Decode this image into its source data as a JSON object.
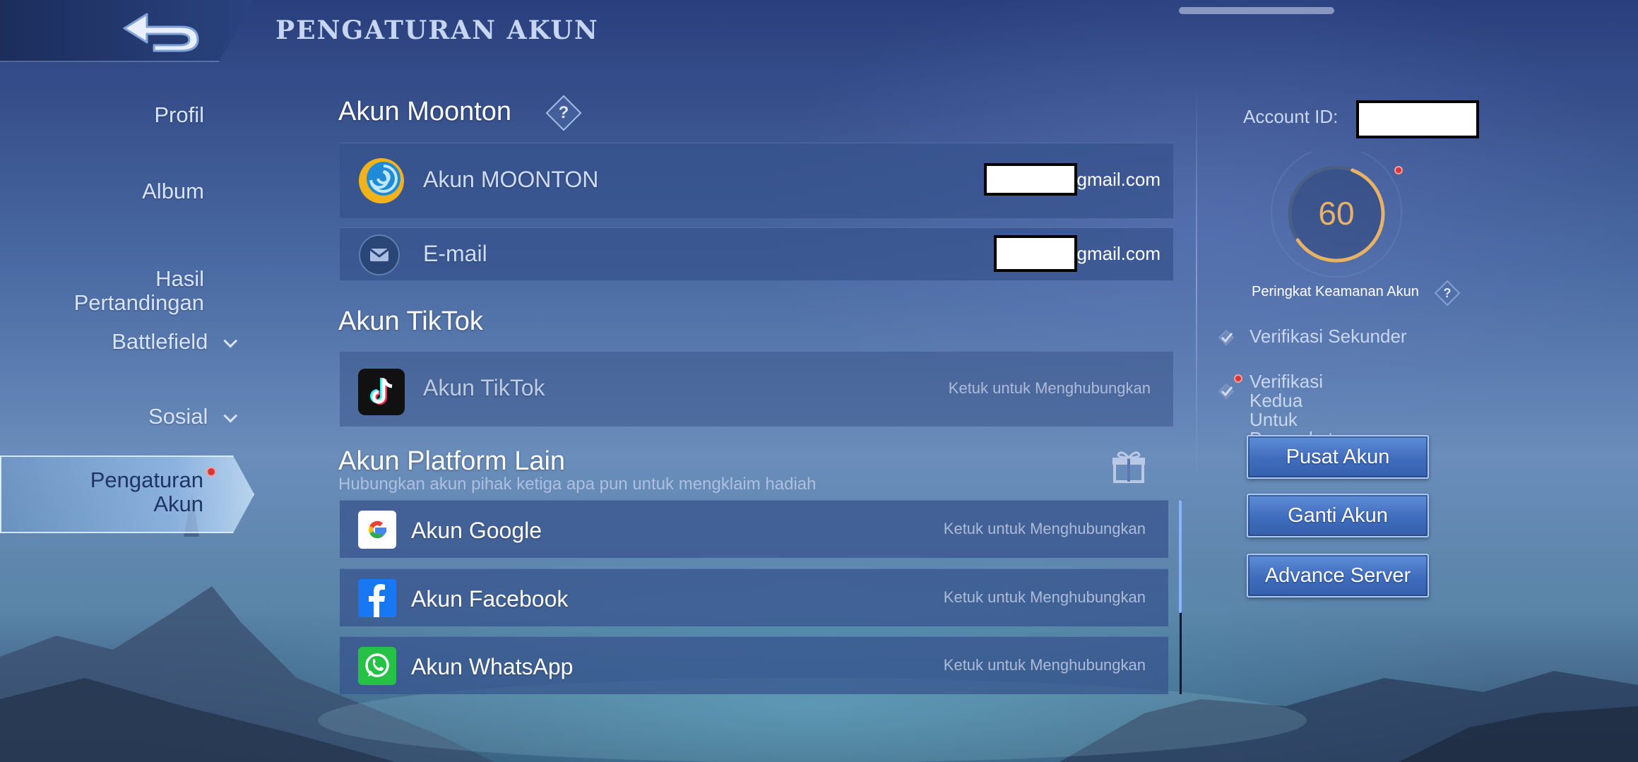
{
  "header": {
    "title": "PENGATURAN AKUN"
  },
  "nav": {
    "items": [
      {
        "label": "Profil"
      },
      {
        "label": "Album"
      },
      {
        "label": "Hasil\nPertandingan"
      },
      {
        "label": "Battlefield",
        "expandable": true
      },
      {
        "label": "Sosial",
        "expandable": true
      }
    ],
    "active": {
      "label": "Pengaturan\nAkun",
      "has_notification": true
    }
  },
  "moonton": {
    "section_title": "Akun Moonton",
    "account_row": {
      "label": "Akun MOONTON",
      "value_suffix": "gmail.com"
    },
    "email_row": {
      "label": "E-mail",
      "value_suffix": "gmail.com"
    }
  },
  "tiktok": {
    "section_title": "Akun TikTok",
    "row": {
      "label": "Akun TikTok",
      "action": "Ketuk untuk Menghubungkan"
    }
  },
  "other_platforms": {
    "section_title": "Akun Platform Lain",
    "subtitle": "Hubungkan akun pihak ketiga apa pun untuk mengklaim hadiah",
    "rows": [
      {
        "label": "Akun Google",
        "action": "Ketuk untuk Menghubungkan",
        "icon": "google-icon"
      },
      {
        "label": "Akun Facebook",
        "action": "Ketuk untuk Menghubungkan",
        "icon": "facebook-icon"
      },
      {
        "label": "Akun WhatsApp",
        "action": "Ketuk untuk Menghubungkan",
        "icon": "whatsapp-icon"
      }
    ]
  },
  "right_panel": {
    "account_id_label": "Account ID:",
    "security_score": "60",
    "security_score_fraction": 0.6,
    "security_label": "Peringkat Keamanan Akun",
    "checks": [
      {
        "label": "Verifikasi Sekunder",
        "has_notification": false
      },
      {
        "label": "Verifikasi Kedua Untuk\nPerangkat Baru",
        "has_notification": true
      }
    ],
    "buttons": [
      {
        "label": "Pusat Akun"
      },
      {
        "label": "Ganti Akun"
      },
      {
        "label": "Advance Server"
      }
    ]
  },
  "colors": {
    "accent_gold": "#e7b267",
    "row_bg": "#36528c",
    "button_blue": "#3f6cbd",
    "notification_red": "#d23a3a"
  }
}
